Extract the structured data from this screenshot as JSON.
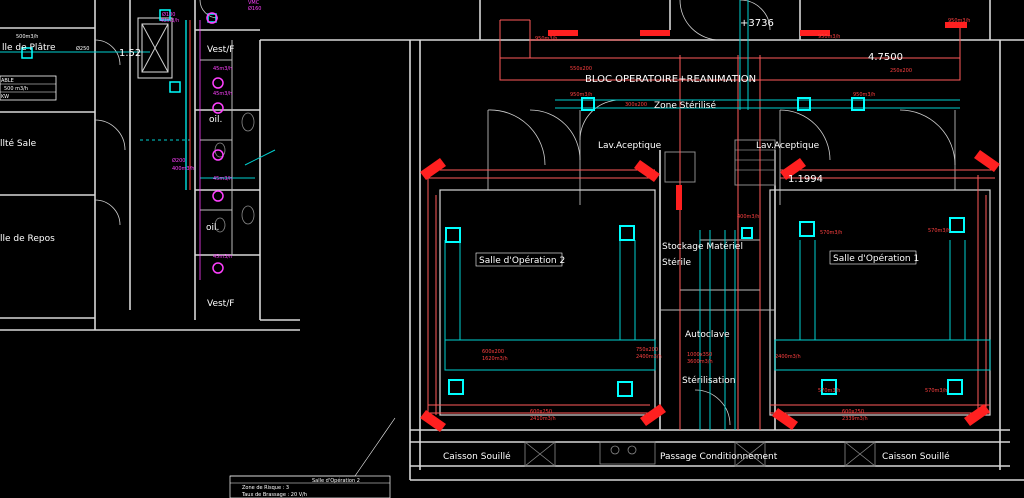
{
  "rooms": {
    "salle_platre": "lle de Plâtre",
    "salle_sale": "llté Sale",
    "salle_repos": "lle de Repos",
    "vest_top": "Vest/F",
    "vest_bottom": "Vest/F",
    "toil1": "oil.",
    "toil2": "oil.",
    "bloc": "BLOC OPERATOIRE+REANIMATION",
    "zone_sterile": "Zone Stérilisé",
    "lav_left": "Lav.Aceptique",
    "lav_right": "Lav.Aceptique",
    "salle_op2": "Salle d'Opération 2",
    "salle_op1": "Salle d'Opération 1",
    "stockage1": "Stockage Matériel",
    "stockage2": "Stérile",
    "autoclave": "Autoclave",
    "sterilisation": "Stérilisation",
    "caisson_left": "Caisson Souillé",
    "caisson_right": "Caisson Souillé",
    "passage": "Passage Conditionnement"
  },
  "dimensions": {
    "d1": "1.52",
    "d2": "+3736",
    "d3": "4.7500",
    "d4": "1.1994"
  },
  "airflows": {
    "f1": "950m3/h",
    "f2": "950m3/h",
    "f3": "950m3/h",
    "f4": "950m3/h",
    "f5": "950m3/h",
    "f6": "400m3/h",
    "f7": "570m3/h",
    "f8": "570m3/h",
    "f9": "570m3/h",
    "f10": "570m3/h",
    "f11": "600x200",
    "f12": "1620m3/h",
    "f13": "750x200",
    "f14": "2400m3/h",
    "f15": "600x250",
    "f16": "2410m3/h",
    "f17": "300x200",
    "f18": "1000x350",
    "f19": "3600m3/h",
    "f20": "250x200",
    "f21": "550x200",
    "f22": "2400m3/h",
    "f23": "600x250",
    "f24": "2339m3/h"
  },
  "magenta": {
    "m1": "Ø100",
    "m2": "40m3/h",
    "m3": "VMC",
    "m4": "Ø160",
    "m5": "45m3/h",
    "m6": "45m3/h",
    "m7": "45m3/h",
    "m8": "45m3/h",
    "m9": "Ø200",
    "m10": "400m3/h"
  },
  "legend": {
    "l1": "500m3/h",
    "l2": "ABLE",
    "l3": "500 m3/h",
    "l4": "KW",
    "l5": "Ø250"
  },
  "titleblock": {
    "title": "Salle d'Opération 2",
    "line1": "Zone de Risque : 3",
    "line2": "Taux de Brassage : 20 V/h"
  }
}
